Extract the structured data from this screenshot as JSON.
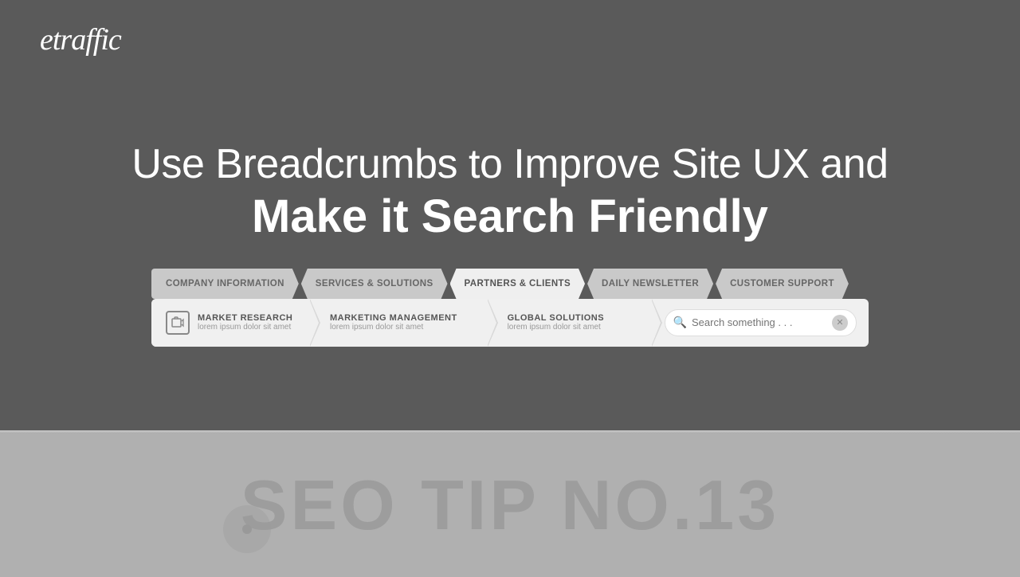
{
  "logo": {
    "text": "etraffic"
  },
  "hero": {
    "line1": "Use Breadcrumbs to Improve Site UX and",
    "line2": "Make it Search Friendly"
  },
  "nav": {
    "tabs": [
      {
        "id": "company",
        "label": "COMPANY INFORMATION",
        "active": false
      },
      {
        "id": "services",
        "label": "SERVICES & SOLUTIONS",
        "active": false
      },
      {
        "id": "partners",
        "label": "PARTNERS & CLIENTS",
        "active": true
      },
      {
        "id": "newsletter",
        "label": "DAILY NEWSLETTER",
        "active": false
      },
      {
        "id": "support",
        "label": "CUSTOMER SUPPORT",
        "active": false
      }
    ]
  },
  "breadcrumbs": {
    "items": [
      {
        "id": "market",
        "title": "MARKET RESEARCH",
        "subtitle": "lorem ipsum dolor sit amet",
        "has_icon": true
      },
      {
        "id": "marketing",
        "title": "MARKETING MANAGEMENT",
        "subtitle": "lorem ipsum dolor sit amet",
        "has_icon": false
      },
      {
        "id": "global",
        "title": "GLOBAL SOLUTIONS",
        "subtitle": "lorem ipsum dolor sit amet",
        "has_icon": false
      }
    ],
    "search_placeholder": "Search something . . ."
  },
  "bottom": {
    "seo_tip": "SEO TIP NO.13"
  }
}
